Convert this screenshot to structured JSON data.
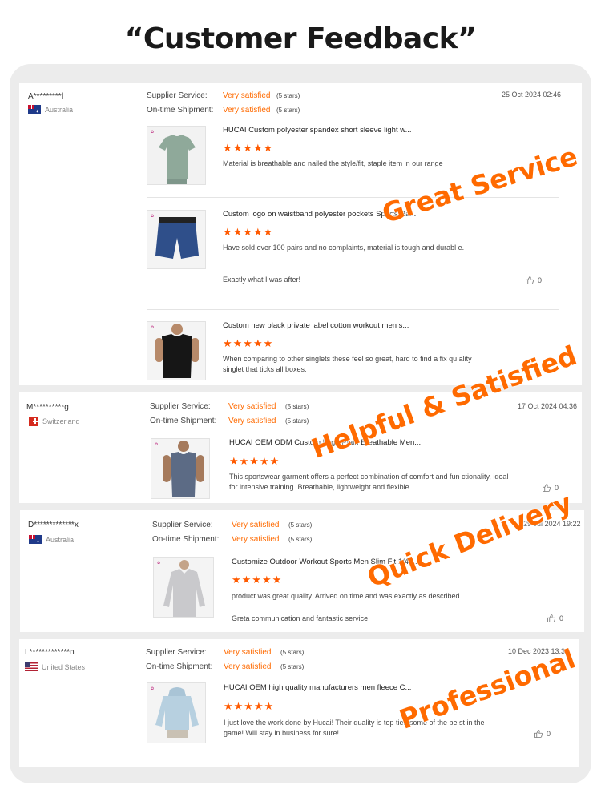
{
  "page": {
    "title": "“Customer Feedback”"
  },
  "labels": {
    "supplier_service": "Supplier Service:",
    "ontime_shipment": "On-time Shipment:"
  },
  "reviews": [
    {
      "reviewer": "A*********l",
      "country": "Australia",
      "date": "25 Oct 2024 02:46",
      "supplier_value": "Very satisfied",
      "supplier_stars": "(5 stars)",
      "shipment_value": "Very satisfied",
      "shipment_stars": "(5 stars)",
      "products": [
        {
          "title": "HUCAI Custom polyester spandex short sleeve light w...",
          "stars": "★★★★★",
          "comment": "Material is breathable and nailed the style/fit, staple item in our range"
        },
        {
          "title": "Custom logo on waistband polyester pockets Sports Ra...",
          "stars": "★★★★★",
          "comment": "Have sold over 100 pairs and no complaints, material is tough and durabl e.",
          "comment2": "Exactly what I was after!",
          "likes": "0"
        },
        {
          "title": "Custom new black private label cotton workout men s...",
          "stars": "★★★★★",
          "comment": "When comparing to other singlets these feel so great, hard to find a fix qu ality singlet that ticks all boxes."
        }
      ]
    },
    {
      "reviewer": "M**********g",
      "country": "Switzerland",
      "date": "17 Oct 2024 04:36",
      "supplier_value": "Very satisfied",
      "supplier_stars": "(5 stars)",
      "shipment_value": "Very satisfied",
      "shipment_stars": "(5 stars)",
      "products": [
        {
          "title": "HUCAI OEM ODM Custom Logo Plain Breathable Men...",
          "stars": "★★★★★",
          "comment": "This sportswear garment offers a perfect combination of comfort and fun ctionality, ideal for intensive training. Breathable, lightweight and flexible.",
          "likes": "0"
        }
      ]
    },
    {
      "reviewer": "D*************x",
      "country": "Australia",
      "date": "29 Jul 2024 19:22",
      "supplier_value": "Very satisfied",
      "supplier_stars": "(5 stars)",
      "shipment_value": "Very satisfied",
      "shipment_stars": "(5 stars)",
      "products": [
        {
          "title": "Customize Outdoor Workout Sports Men Slim Fit 1/4 ...",
          "stars": "★★★★★",
          "comment": "product was great quality. Arrived on time and was exactly as described.",
          "comment2": "Greta communication and fantastic service",
          "likes": "0"
        }
      ]
    },
    {
      "reviewer": "L*************n",
      "country": "United States",
      "date": "10 Dec 2023 13:30",
      "supplier_value": "Very satisfied",
      "supplier_stars": "(5 stars)",
      "shipment_value": "Very satisfied",
      "shipment_stars": "(5 stars)",
      "products": [
        {
          "title": "HUCAI OEM high quality manufacturers men fleece C...",
          "stars": "★★★★★",
          "comment": "I just love the work done by Hucai! Their quality is top tier, some of the be st in the game! Will stay in business for sure!",
          "likes": "0"
        }
      ]
    }
  ],
  "stamps": [
    "Great Service",
    "Helpful & Satisfied",
    "Quick Delivery",
    "Professional"
  ],
  "colors": {
    "accent": "#ff6a00",
    "stars": "#ff5a00",
    "frame": "#ececec"
  },
  "icons": {
    "like": "thumbs-up-icon",
    "brand": "hucai-logo-icon"
  }
}
